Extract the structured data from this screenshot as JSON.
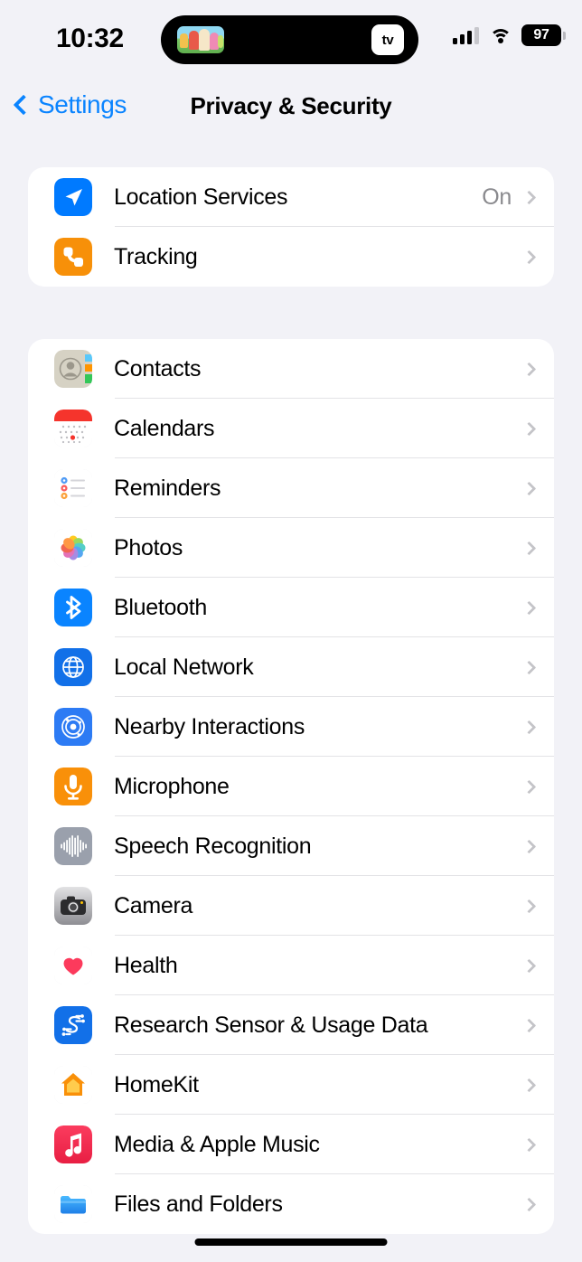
{
  "status_bar": {
    "time": "10:32",
    "dynamic_island": {
      "media_thumbnail": "cartoon-album-art",
      "app_badge": "apple-tv-badge",
      "app_badge_text": "tv"
    },
    "cellular_icon": "signal-bars-icon",
    "cellular_bars_filled": 3,
    "cellular_bars_total": 4,
    "wifi_icon": "wifi-icon",
    "battery_percent": "97",
    "battery_icon": "battery-icon"
  },
  "nav": {
    "back_label": "Settings",
    "back_icon": "chevron-left-icon",
    "title": "Privacy & Security"
  },
  "sections": [
    {
      "id": "location-section",
      "rows": [
        {
          "label": "Location Services",
          "value": "On",
          "icon": "location-arrow-icon",
          "icon_style": "location"
        },
        {
          "label": "Tracking",
          "value": "",
          "icon": "tracking-icon",
          "icon_style": "tracking"
        }
      ]
    },
    {
      "id": "app-permissions-section",
      "rows": [
        {
          "label": "Contacts",
          "value": "",
          "icon": "contacts-icon",
          "icon_style": "contacts"
        },
        {
          "label": "Calendars",
          "value": "",
          "icon": "calendar-icon",
          "icon_style": "calendars"
        },
        {
          "label": "Reminders",
          "value": "",
          "icon": "reminders-icon",
          "icon_style": "reminders"
        },
        {
          "label": "Photos",
          "value": "",
          "icon": "photos-icon",
          "icon_style": "photos"
        },
        {
          "label": "Bluetooth",
          "value": "",
          "icon": "bluetooth-icon",
          "icon_style": "bluetooth"
        },
        {
          "label": "Local Network",
          "value": "",
          "icon": "globe-icon",
          "icon_style": "localnetwork"
        },
        {
          "label": "Nearby Interactions",
          "value": "",
          "icon": "radar-icon",
          "icon_style": "nearby"
        },
        {
          "label": "Microphone",
          "value": "",
          "icon": "microphone-icon",
          "icon_style": "microphone"
        },
        {
          "label": "Speech Recognition",
          "value": "",
          "icon": "waveform-icon",
          "icon_style": "speech"
        },
        {
          "label": "Camera",
          "value": "",
          "icon": "camera-icon",
          "icon_style": "camera"
        },
        {
          "label": "Health",
          "value": "",
          "icon": "heart-icon",
          "icon_style": "health"
        },
        {
          "label": "Research Sensor & Usage Data",
          "value": "",
          "icon": "research-sensor-icon",
          "icon_style": "research"
        },
        {
          "label": "HomeKit",
          "value": "",
          "icon": "home-icon",
          "icon_style": "homekit"
        },
        {
          "label": "Media & Apple Music",
          "value": "",
          "icon": "music-note-icon",
          "icon_style": "media"
        },
        {
          "label": "Files and Folders",
          "value": "",
          "icon": "folder-icon",
          "icon_style": "files"
        }
      ]
    }
  ],
  "colors": {
    "page_background": "#F2F2F7",
    "card_background": "#FFFFFF",
    "accent_blue": "#0A84FF",
    "label": "#000000",
    "secondary_label": "#8A8A8E",
    "separator": "#E3E3E6",
    "chevron": "#C4C4C8"
  }
}
